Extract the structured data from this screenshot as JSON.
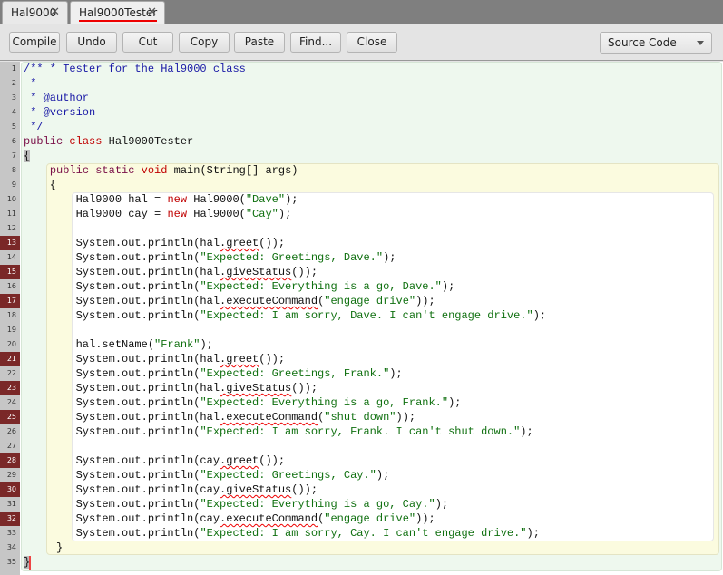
{
  "tabs": [
    {
      "label": "Hal9000",
      "active": false
    },
    {
      "label": "Hal9000Tester",
      "active": true
    }
  ],
  "toolbar": {
    "buttons": [
      "Compile",
      "Undo",
      "Cut",
      "Copy",
      "Paste",
      "Find...",
      "Close"
    ],
    "view_mode": "Source Code"
  },
  "error_lines": [
    13,
    15,
    17,
    21,
    23,
    25,
    28,
    30,
    32
  ],
  "code": [
    [
      [
        "c",
        "/** * Tester for the Hal9000 class"
      ]
    ],
    [
      [
        "c",
        " *"
      ]
    ],
    [
      [
        "c",
        " * @author"
      ]
    ],
    [
      [
        "c",
        " * @version"
      ]
    ],
    [
      [
        "c",
        " */"
      ]
    ],
    [
      [
        "k",
        "public "
      ],
      [
        "k2",
        "class"
      ],
      [
        "p",
        " Hal9000Tester"
      ]
    ],
    [
      [
        "b",
        "{"
      ]
    ],
    [
      [
        "p",
        "    "
      ],
      [
        "k",
        "public static "
      ],
      [
        "k2",
        "void"
      ],
      [
        "p",
        " main(String[] args)"
      ]
    ],
    [
      [
        "p",
        "    {"
      ]
    ],
    [
      [
        "p",
        "        Hal9000 hal = "
      ],
      [
        "k2",
        "new"
      ],
      [
        "p",
        " Hal9000("
      ],
      [
        "s",
        "\"Dave\""
      ],
      [
        "p",
        ");"
      ]
    ],
    [
      [
        "p",
        "        Hal9000 cay = "
      ],
      [
        "k2",
        "new"
      ],
      [
        "p",
        " Hal9000("
      ],
      [
        "s",
        "\"Cay\""
      ],
      [
        "p",
        ");"
      ]
    ],
    [
      [
        "p",
        ""
      ]
    ],
    [
      [
        "p",
        "        System.out.println(hal"
      ],
      [
        "e",
        ".greet"
      ],
      [
        "p",
        "());"
      ]
    ],
    [
      [
        "p",
        "        System.out.println("
      ],
      [
        "s",
        "\"Expected: Greetings, Dave.\""
      ],
      [
        "p",
        ");"
      ]
    ],
    [
      [
        "p",
        "        System.out.println(hal"
      ],
      [
        "e",
        ".giveStatus"
      ],
      [
        "p",
        "());"
      ]
    ],
    [
      [
        "p",
        "        System.out.println("
      ],
      [
        "s",
        "\"Expected: Everything is a go, Dave.\""
      ],
      [
        "p",
        ");"
      ]
    ],
    [
      [
        "p",
        "        System.out.println(hal"
      ],
      [
        "e",
        ".executeCommand"
      ],
      [
        "p",
        "("
      ],
      [
        "s",
        "\"engage drive\""
      ],
      [
        "p",
        "));"
      ]
    ],
    [
      [
        "p",
        "        System.out.println("
      ],
      [
        "s",
        "\"Expected: I am sorry, Dave. I can't engage drive.\""
      ],
      [
        "p",
        ");"
      ]
    ],
    [
      [
        "p",
        ""
      ]
    ],
    [
      [
        "p",
        "        hal.setName("
      ],
      [
        "s",
        "\"Frank\""
      ],
      [
        "p",
        ");"
      ]
    ],
    [
      [
        "p",
        "        System.out.println(hal"
      ],
      [
        "e",
        ".greet"
      ],
      [
        "p",
        "());"
      ]
    ],
    [
      [
        "p",
        "        System.out.println("
      ],
      [
        "s",
        "\"Expected: Greetings, Frank.\""
      ],
      [
        "p",
        ");"
      ]
    ],
    [
      [
        "p",
        "        System.out.println(hal"
      ],
      [
        "e",
        ".giveStatus"
      ],
      [
        "p",
        "());"
      ]
    ],
    [
      [
        "p",
        "        System.out.println("
      ],
      [
        "s",
        "\"Expected: Everything is a go, Frank.\""
      ],
      [
        "p",
        ");"
      ]
    ],
    [
      [
        "p",
        "        System.out.println(hal"
      ],
      [
        "e",
        ".executeCommand"
      ],
      [
        "p",
        "("
      ],
      [
        "s",
        "\"shut down\""
      ],
      [
        "p",
        "));"
      ]
    ],
    [
      [
        "p",
        "        System.out.println("
      ],
      [
        "s",
        "\"Expected: I am sorry, Frank. I can't shut down.\""
      ],
      [
        "p",
        ");"
      ]
    ],
    [
      [
        "p",
        ""
      ]
    ],
    [
      [
        "p",
        "        System.out.println(cay"
      ],
      [
        "e",
        ".greet"
      ],
      [
        "p",
        "());"
      ]
    ],
    [
      [
        "p",
        "        System.out.println("
      ],
      [
        "s",
        "\"Expected: Greetings, Cay.\""
      ],
      [
        "p",
        ");"
      ]
    ],
    [
      [
        "p",
        "        System.out.println(cay"
      ],
      [
        "e",
        ".giveStatus"
      ],
      [
        "p",
        "());"
      ]
    ],
    [
      [
        "p",
        "        System.out.println("
      ],
      [
        "s",
        "\"Expected: Everything is a go, Cay.\""
      ],
      [
        "p",
        ");"
      ]
    ],
    [
      [
        "p",
        "        System.out.println(cay"
      ],
      [
        "e",
        ".executeCommand"
      ],
      [
        "p",
        "("
      ],
      [
        "s",
        "\"engage drive\""
      ],
      [
        "p",
        "));"
      ]
    ],
    [
      [
        "p",
        "        System.out.println("
      ],
      [
        "s",
        "\"Expected: I am sorry, Cay. I can't engage drive.\""
      ],
      [
        "p",
        ");"
      ]
    ],
    [
      [
        "p",
        "     }"
      ]
    ],
    [
      [
        "b",
        "}"
      ]
    ]
  ]
}
